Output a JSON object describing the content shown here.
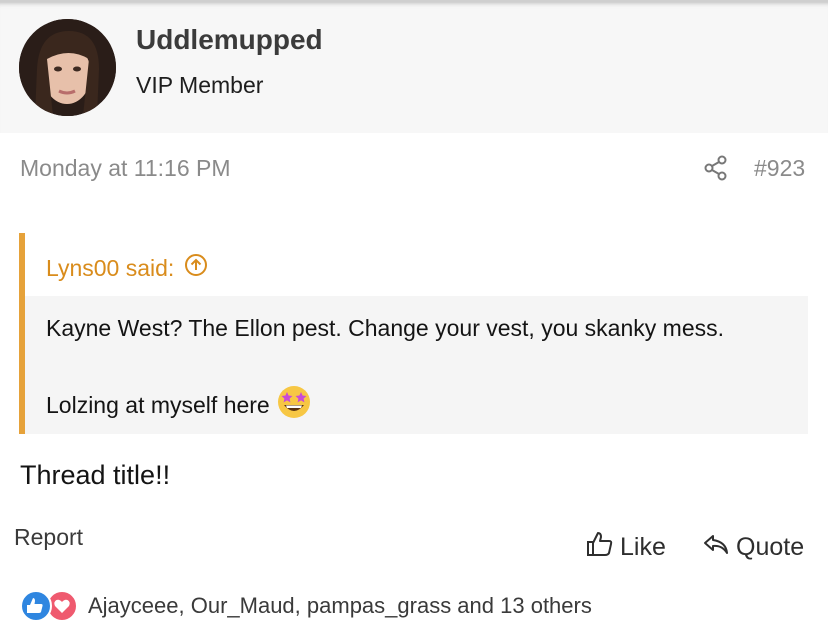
{
  "user": {
    "name": "Uddlemupped",
    "title": "VIP Member"
  },
  "post": {
    "date": "Monday at 11:16 PM",
    "number": "#923",
    "body": "Thread title!!"
  },
  "quote": {
    "author_label": "Lyns00 said:",
    "line1": "Kayne West? The Ellon pest. Change your vest, you skanky mess.",
    "line2": "Lolzing at myself here"
  },
  "actions": {
    "report": "Report",
    "like": "Like",
    "quote": "Quote"
  },
  "reactions": {
    "users": "Ajayceee, Our_Maud, pampas_grass and 13 others"
  },
  "colors": {
    "accent_quote": "#e6a23a",
    "quote_author": "#d98c1c",
    "like_reaction": "#2f86e0",
    "love_reaction": "#ef5a6f"
  }
}
